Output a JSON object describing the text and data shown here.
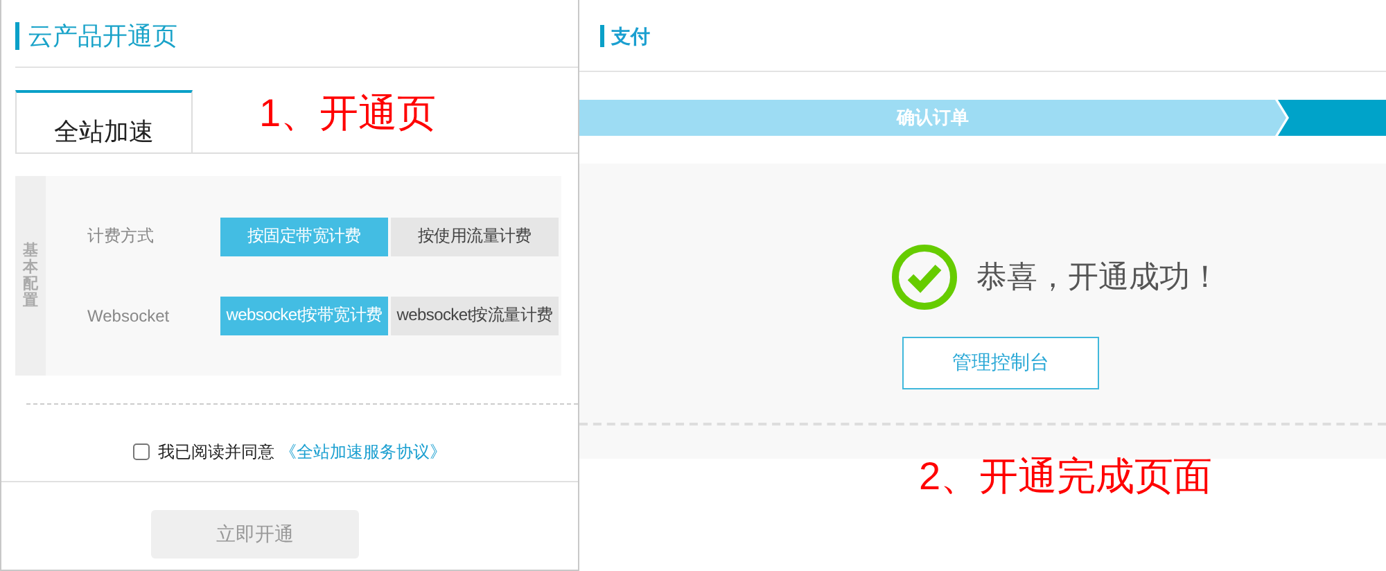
{
  "open_page": {
    "title": "云产品开通页",
    "tabs": [
      {
        "label": "全站加速",
        "selected": true
      }
    ],
    "annotation": "1、开通页",
    "config": {
      "section_label": "基本配置",
      "rows": [
        {
          "label": "计费方式",
          "options": [
            {
              "label": "按固定带宽计费",
              "selected": true
            },
            {
              "label": "按使用流量计费",
              "selected": false
            }
          ]
        },
        {
          "label": "Websocket",
          "options": [
            {
              "label": "websocket按带宽计费",
              "selected": true
            },
            {
              "label": "websocket按流量计费",
              "selected": false
            }
          ]
        }
      ]
    },
    "agreement": {
      "checked": false,
      "text": "我已阅读并同意",
      "link": "《全站加速服务协议》"
    },
    "submit": {
      "label": "立即开通",
      "disabled": true
    }
  },
  "done_page": {
    "title": "支付",
    "steps": [
      {
        "label": "确认订单",
        "selected": false
      },
      {
        "selected": true
      }
    ],
    "message": "恭喜，开通成功！",
    "button": "管理控制台",
    "annotation": "2、开通完成页面"
  }
}
